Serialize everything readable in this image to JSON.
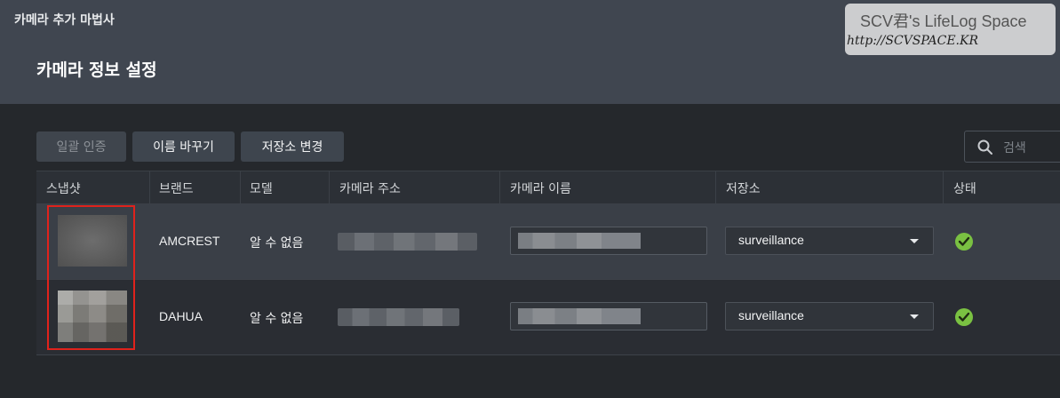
{
  "window": {
    "title": "카메라 추가 마법사"
  },
  "page": {
    "title": "카메라 정보 설정"
  },
  "watermark": {
    "line1": "SCV君's LifeLog Space",
    "line2": "http://SCVSPACE.KR"
  },
  "toolbar": {
    "bulk_auth_label": "일괄 인증",
    "rename_label": "이름 바꾸기",
    "change_storage_label": "저장소 변경"
  },
  "search": {
    "placeholder": "검색"
  },
  "table": {
    "columns": {
      "snapshot": "스냅샷",
      "brand": "브랜드",
      "model": "모델",
      "address": "카메라 주소",
      "name": "카메라 이름",
      "storage": "저장소",
      "status": "상태"
    },
    "rows": [
      {
        "brand": "AMCREST",
        "model": "알 수 없음",
        "storage": "surveillance",
        "status_icon": "check-circle-icon"
      },
      {
        "brand": "DAHUA",
        "model": "알 수 없음",
        "storage": "surveillance",
        "status_icon": "check-circle-icon"
      }
    ]
  },
  "colors": {
    "status_ok": "#7ac142",
    "highlight": "#e0221c"
  }
}
